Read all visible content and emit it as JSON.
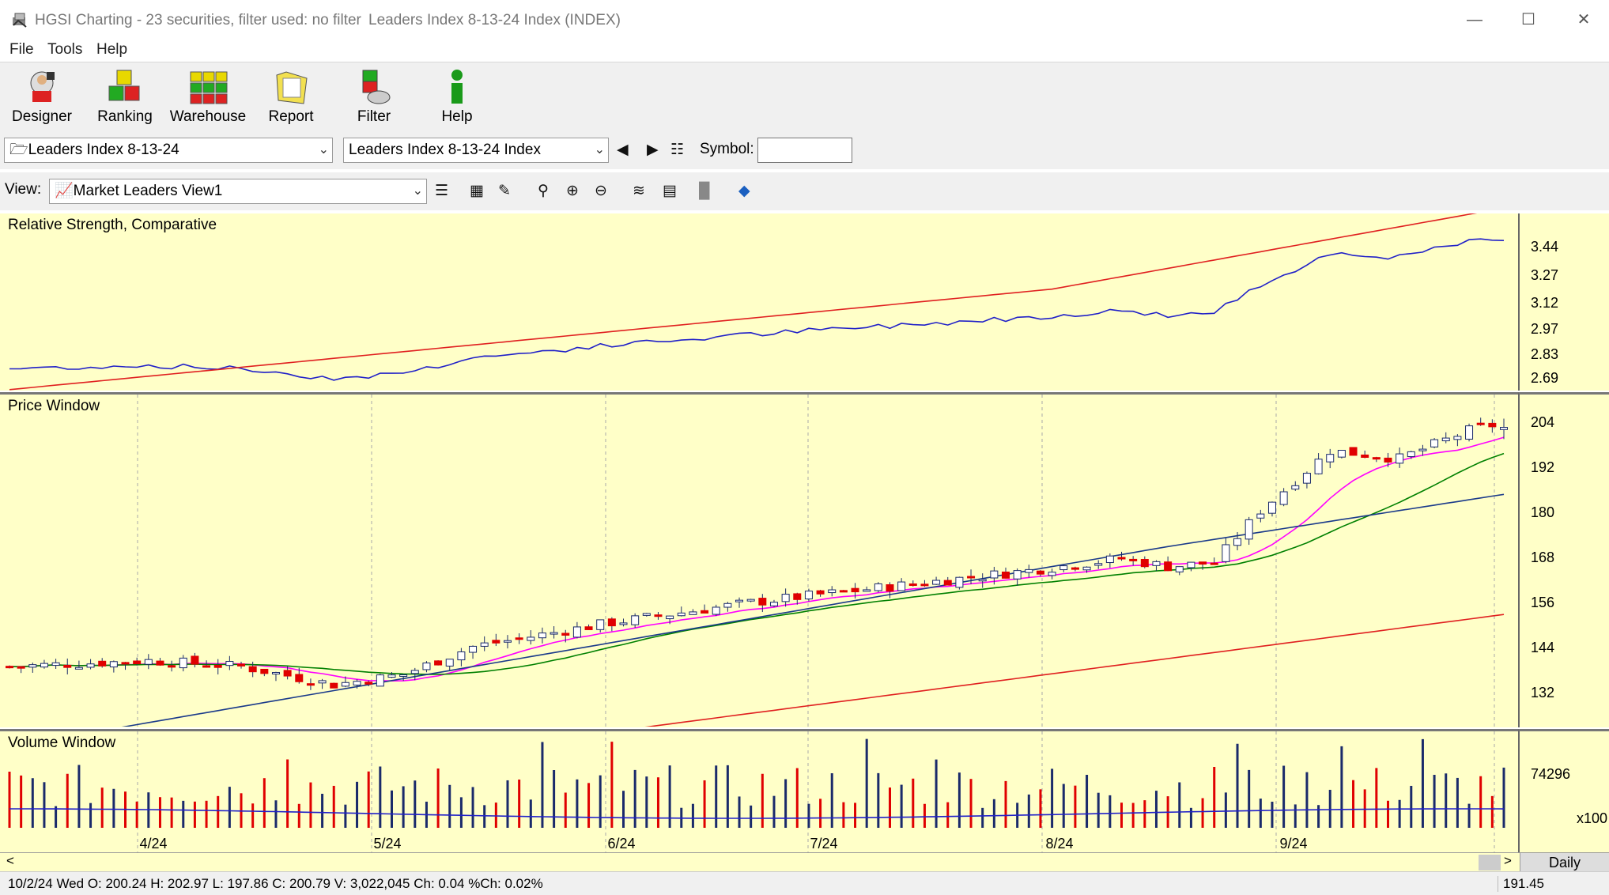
{
  "window": {
    "app_title": "HGSI Charting - 23 securities, filter used: no filter",
    "doc_title": "Leaders Index 8-13-24 Index (INDEX)"
  },
  "menu": [
    "File",
    "Tools",
    "Help"
  ],
  "toolbar": [
    "Designer",
    "Ranking",
    "Warehouse",
    "Report",
    "Filter",
    "Help"
  ],
  "row2": {
    "list_combo": "Leaders Index 8-13-24",
    "security_combo": "Leaders Index 8-13-24 Index",
    "symbol_label": "Symbol:",
    "symbol_value": ""
  },
  "row3": {
    "view_label": "View:",
    "view_combo": "Market Leaders View1"
  },
  "rs_panel": {
    "title": "Relative Strength, Comparative",
    "ticks": [
      "3.44",
      "3.27",
      "3.12",
      "2.97",
      "2.83",
      "2.69"
    ]
  },
  "price_panel": {
    "title": "Price Window",
    "ticks": [
      "204",
      "192",
      "180",
      "168",
      "156",
      "144",
      "132"
    ]
  },
  "volume_panel": {
    "title": "Volume Window",
    "ticks": [
      "74296"
    ],
    "scale": "x100"
  },
  "date_axis": [
    "4/24",
    "5/24",
    "6/24",
    "7/24",
    "8/24",
    "9/24"
  ],
  "period": "Daily",
  "status": {
    "quote": "10/2/24 Wed O: 200.24 H: 202.97 L: 197.86 C: 200.79 V: 3,022,045 Ch: 0.04 %Ch: 0.02%",
    "cursor_value": "191.45"
  },
  "colors": {
    "panel_bg": "#ffffc8",
    "up_candle": "#ffffff",
    "down_candle": "#e00000",
    "rs_line": "#2020c8",
    "rs_ma": "#e02020",
    "ma_fast": "#ff00ff",
    "ma_mid": "#008000",
    "ma_slow": "#1a3a8a",
    "ma_long": "#e02020"
  },
  "chart_data": {
    "type": "candlestick",
    "period": "Daily",
    "ohlc_last": {
      "date": "10/2/24",
      "open": 200.24,
      "high": 202.97,
      "low": 197.86,
      "close": 200.79,
      "volume": 3022045
    },
    "price_range": [
      126,
      209
    ],
    "rs_range": [
      2.64,
      3.56
    ]
  }
}
